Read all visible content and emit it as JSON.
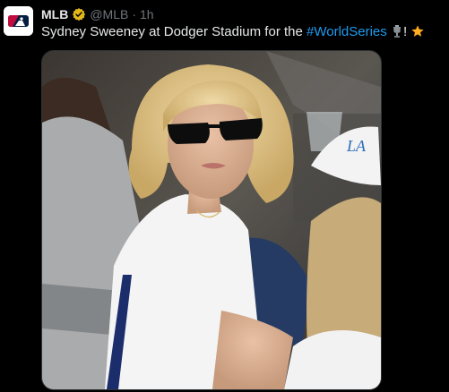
{
  "tweet": {
    "author_name": "MLB",
    "verified_badge_icon": "gold-verified-badge-icon",
    "handle": "@MLB",
    "separator": "·",
    "time": "1h",
    "text_before": "Sydney Sweeney at Dodger Stadium for the ",
    "hashtag": "#WorldSeries",
    "text_after": "!",
    "emoji_icons": [
      "trophy-icon",
      "star-icon"
    ],
    "avatar_icon": "mlb-logo-icon",
    "media_alt_icon": "photo"
  },
  "colors": {
    "background": "#000000",
    "text": "#e7e9ea",
    "muted": "#71767b",
    "link": "#1d9bf0",
    "verified_gold": "#e2b719",
    "star": "#ffad1f"
  }
}
